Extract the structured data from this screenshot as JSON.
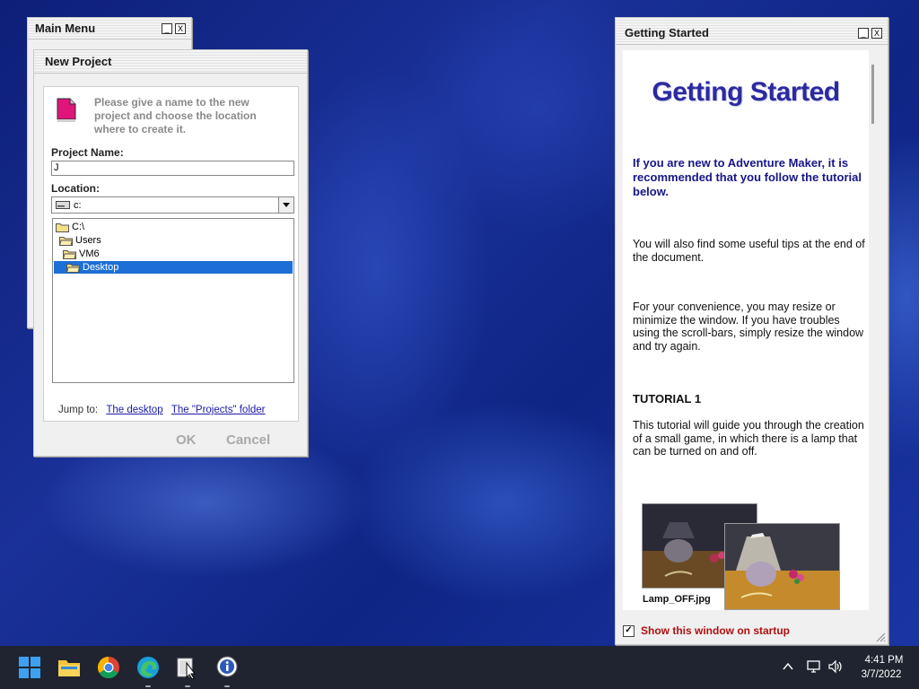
{
  "main_menu": {
    "title": "Main Menu",
    "min_label": "_",
    "close_label": "X"
  },
  "new_project": {
    "title": "New Project",
    "description": "Please give a name to the new project and choose the location where to create it.",
    "project_name_label": "Project Name:",
    "project_name_value": "J",
    "location_label": "Location:",
    "location_value": "c:",
    "tree": [
      {
        "label": "C:\\",
        "selected": false
      },
      {
        "label": "Users",
        "selected": false
      },
      {
        "label": "VM6",
        "selected": false
      },
      {
        "label": "Desktop",
        "selected": true
      }
    ],
    "jump_to_label": "Jump to:",
    "jump_desktop": "The desktop",
    "jump_projects": "The \"Projects\" folder",
    "ok_label": "OK",
    "cancel_label": "Cancel"
  },
  "getting_started": {
    "title": "Getting Started",
    "min_label": "_",
    "close_label": "X",
    "heading": "Getting Started",
    "intro": "If you are new to Adventure Maker, it is recommended that you follow the tutorial below.",
    "tips": "You will also find some useful tips at the end of the document.",
    "convenience": "For your convenience, you may resize or minimize the window. If you have troubles using the scroll-bars, simply resize the window and try again.",
    "tutorial_title": "TUTORIAL 1",
    "tutorial_desc": "This tutorial will guide you through the creation of a small game, in which there is a lamp that can be turned on and off.",
    "thumb_caption": "Lamp_OFF.jpg",
    "startup_label": "Show this window on startup",
    "startup_checked": "✓"
  },
  "taskbar": {
    "time": "4:41 PM",
    "date": "3/7/2022"
  },
  "colors": {
    "accent_blue": "#2b2aa0",
    "selection": "#1c6fd6",
    "startup_red": "#b01010"
  }
}
